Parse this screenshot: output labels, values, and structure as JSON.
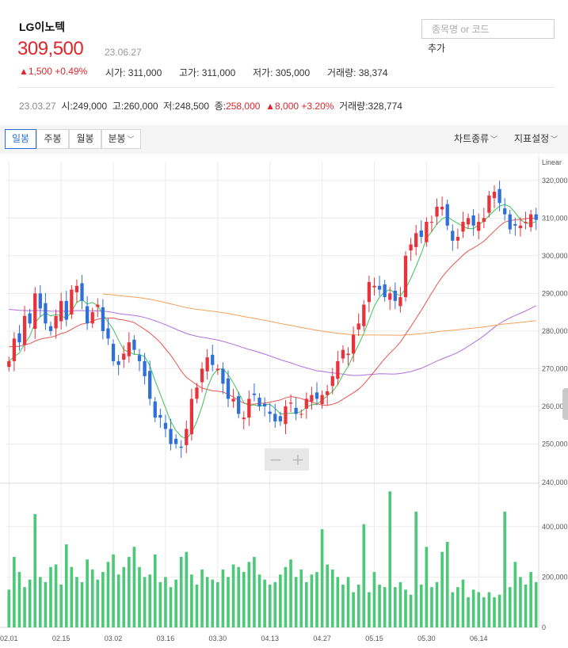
{
  "header": {
    "stock_name": "LG이노텍",
    "price": "309,500",
    "price_date": "23.06.27",
    "change": "▲1,500 +0.49%",
    "quotes": [
      {
        "label": "시가",
        "value": "311,000"
      },
      {
        "label": "고가",
        "value": "311,000"
      },
      {
        "label": "저가",
        "value": "305,000"
      },
      {
        "label": "거래량",
        "value": "38,374"
      }
    ]
  },
  "search": {
    "placeholder": "종목명 or 코드",
    "add_label": "추가"
  },
  "prev": {
    "date": "23.03.27",
    "open": "시:249,000",
    "high": "고:260,000",
    "low": "저:248,500",
    "close_label": "종:",
    "close_value": "258,000",
    "change": "▲8,000 +3.20%",
    "volume": "거래량:328,774"
  },
  "toolbar": {
    "tabs": [
      "일봉",
      "주봉",
      "월봉",
      "분봉"
    ],
    "active_tab": "일봉",
    "chart_type_label": "차트종류",
    "indicator_label": "지표설정"
  },
  "chart_data": {
    "type": "candlestick",
    "scale_label": "Linear",
    "x_tick_labels": [
      "02.01",
      "02.15",
      "03.02",
      "03.16",
      "03.30",
      "04.13",
      "04.27",
      "05.15",
      "05.30",
      "06.14"
    ],
    "price_ticks": [
      "320,000",
      "310,000",
      "300,000",
      "290,000",
      "280,000",
      "270,000",
      "260,000",
      "250,000",
      "240,000"
    ],
    "price_range": [
      240000,
      325000
    ],
    "volume_ticks": [
      "400,000",
      "200,000",
      "0"
    ],
    "volume_range": [
      0,
      560000
    ],
    "colors": {
      "up": "#e8323c",
      "down": "#2f6fd8",
      "volume": "#4cc978",
      "ma5": "#3fc25b",
      "ma20": "#e8564d",
      "ma60": "#b36ee0",
      "ma120": "#f2a25a"
    },
    "closes": [
      272,
      278,
      277,
      284,
      282,
      290,
      286,
      282,
      280,
      284,
      288,
      283,
      291,
      292,
      288,
      282,
      285,
      287,
      280,
      278,
      272,
      271,
      274,
      277,
      275,
      272,
      268,
      262,
      257,
      257,
      254,
      250,
      250,
      249,
      254,
      262,
      265,
      270,
      273,
      271,
      270,
      266,
      262,
      262,
      258,
      257,
      262,
      263,
      260,
      260,
      258,
      256,
      256,
      260,
      261,
      258,
      258,
      262,
      263,
      262,
      263,
      264,
      268,
      272,
      275,
      274,
      279,
      282,
      287,
      293,
      292,
      291,
      289,
      290,
      288,
      289,
      300,
      303,
      306,
      305,
      309,
      309,
      313,
      313,
      308,
      304,
      305,
      309,
      310,
      308,
      309,
      310,
      316,
      317,
      314,
      311,
      307,
      308,
      308,
      309,
      311,
      309.5
    ],
    "volumes": [
      150,
      280,
      220,
      160,
      190,
      450,
      200,
      180,
      240,
      250,
      170,
      330,
      240,
      200,
      180,
      270,
      230,
      190,
      220,
      260,
      290,
      210,
      240,
      280,
      320,
      240,
      200,
      210,
      290,
      180,
      200,
      160,
      190,
      280,
      300,
      210,
      170,
      230,
      200,
      190,
      180,
      230,
      200,
      250,
      240,
      220,
      260,
      280,
      210,
      190,
      170,
      180,
      210,
      240,
      270,
      200,
      230,
      180,
      210,
      220,
      390,
      250,
      230,
      200,
      170,
      200,
      140,
      170,
      410,
      140,
      220,
      170,
      160,
      540,
      160,
      180,
      150,
      130,
      460,
      170,
      320,
      160,
      180,
      300,
      340,
      140,
      160,
      190,
      120,
      150,
      140,
      120,
      140,
      120,
      130,
      460,
      160,
      260,
      200,
      170,
      220,
      180
    ]
  },
  "zoom": {
    "minus": "−",
    "plus": "+"
  }
}
